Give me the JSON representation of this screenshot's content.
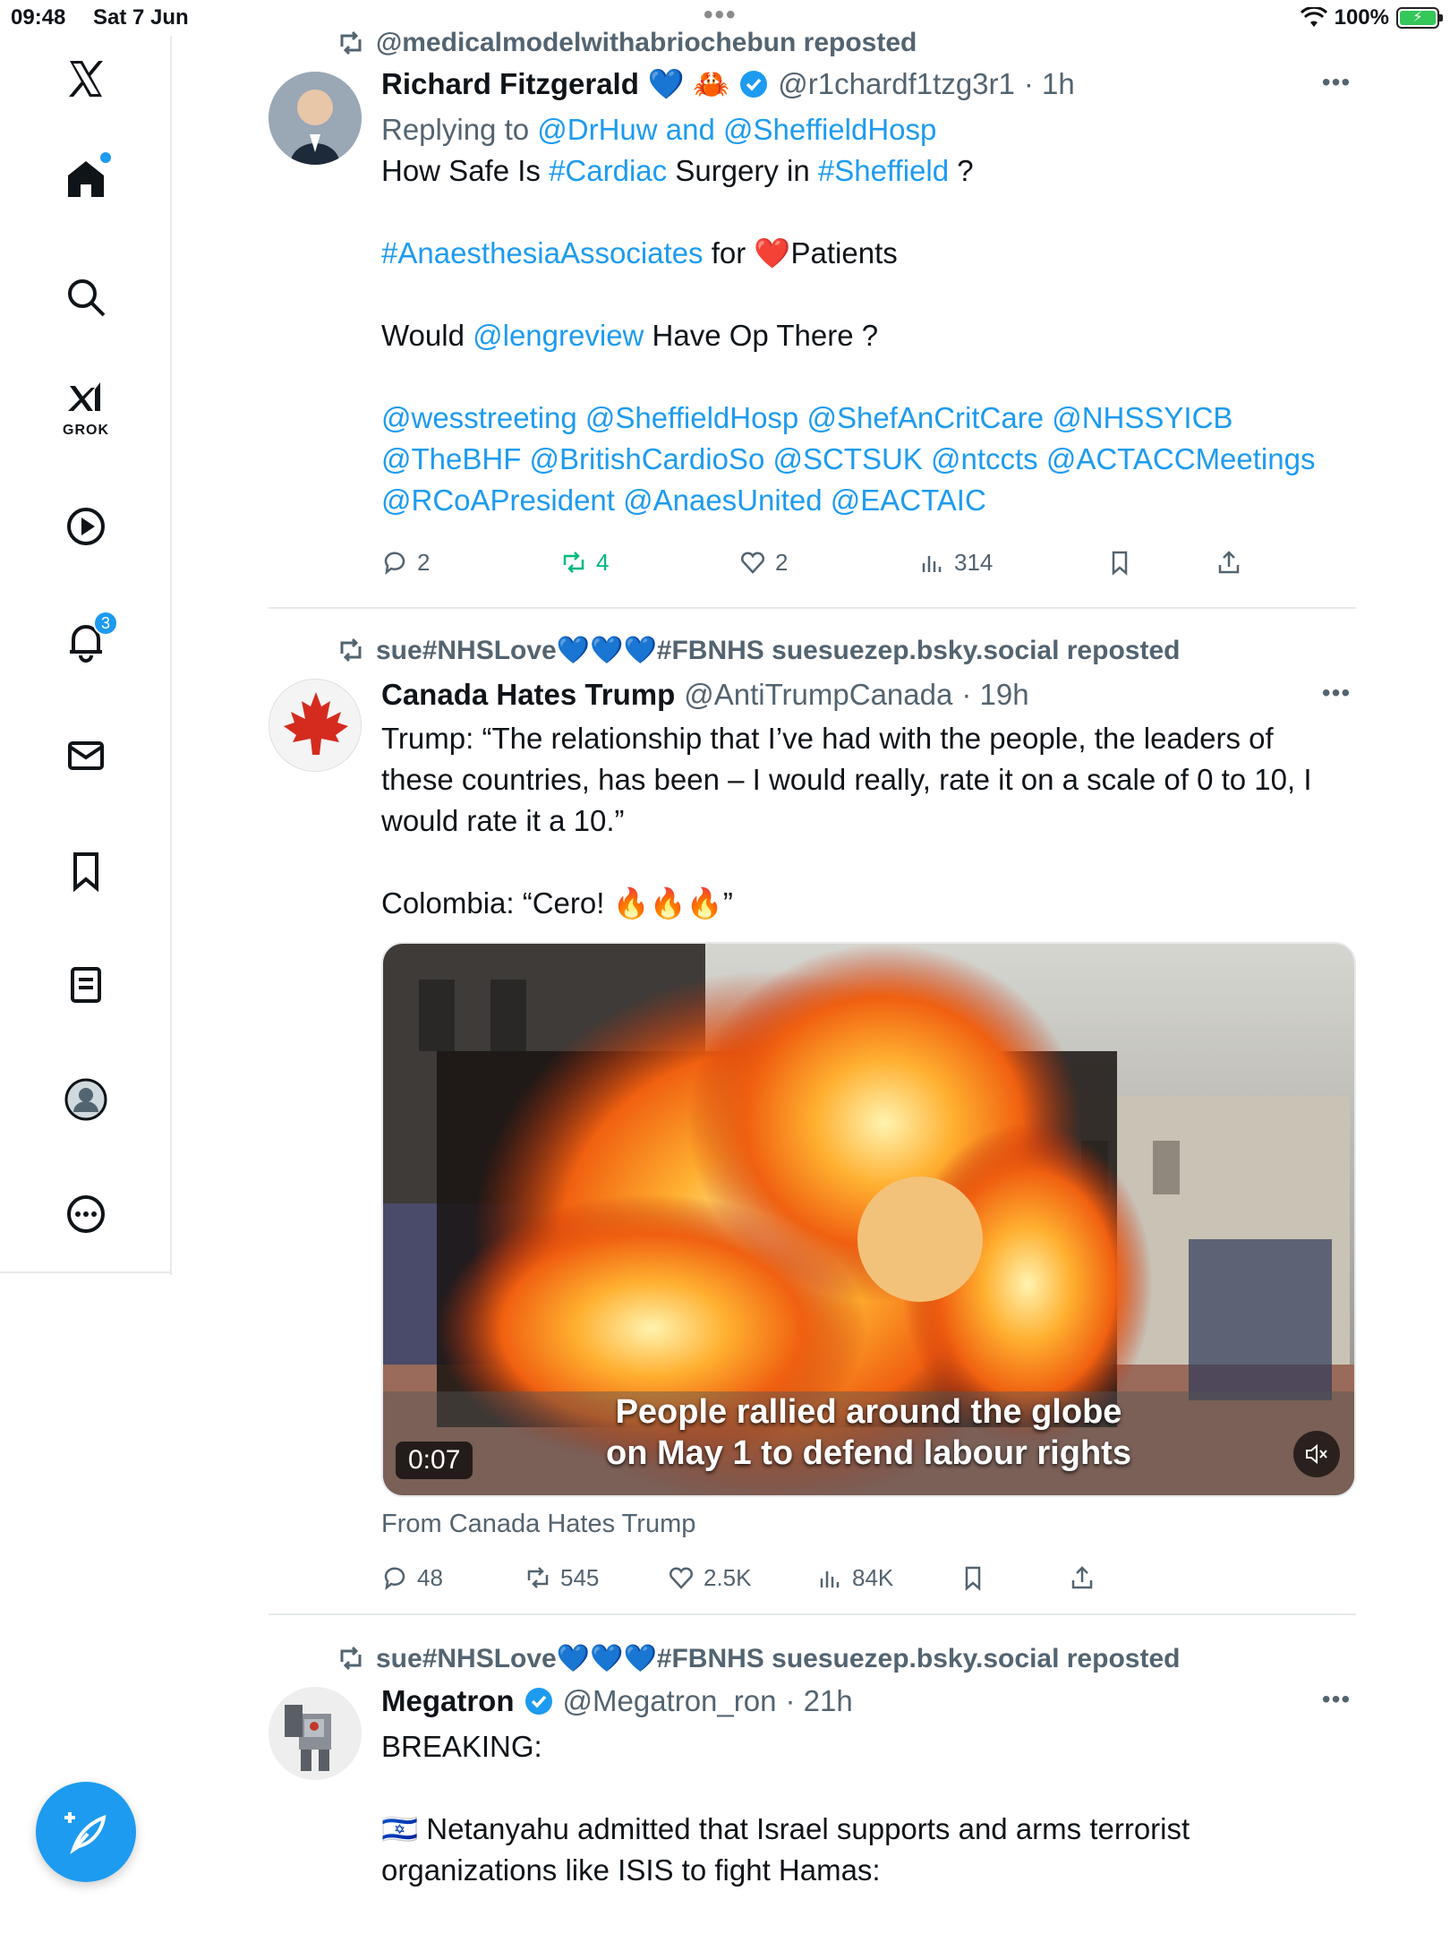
{
  "status_bar": {
    "time": "09:48",
    "date": "Sat 7 Jun",
    "battery": "100%"
  },
  "sidebar": {
    "grok_label": "GROK",
    "notifications_count": "3"
  },
  "tweets": [
    {
      "repost_by": "@medicalmodelwithabriochebun reposted",
      "name": "Richard Fitzgerald",
      "name_emoji": "💙 🦀",
      "handle": "@r1chardf1tzg3r1",
      "time": "· 1h",
      "reply_prefix": "Replying to ",
      "reply_to_1": "@DrHuw",
      "reply_and": " and ",
      "reply_to_2": "@SheffieldHosp",
      "line1_a": "How Safe Is ",
      "line1_b": "#Cardiac",
      "line1_c": " Surgery in ",
      "line1_d": "#Sheffield",
      "line1_e": " ?",
      "line2_a": "#AnaesthesiaAssociates",
      "line2_b": " for ❤️Patients",
      "line3_a": "Would ",
      "line3_b": "@lengreview",
      "line3_c": " Have Op There ?",
      "mentions_1": "@wesstreeting @SheffieldHosp @ShefAnCritCare @NHSSYICB",
      "mentions_2": "@TheBHF @BritishCardioSo @SCTSUK @ntccts @ACTACCMeetings",
      "mentions_3": "@RCoAPresident @AnaesUnited @EACTAIC",
      "replies": "2",
      "reposts": "4",
      "likes": "2",
      "views": "314"
    },
    {
      "repost_by": "sue#NHSLove💙💙💙#FBNHS suesuezep.bsky.social reposted",
      "name": "Canada Hates Trump",
      "handle": "@AntiTrumpCanada",
      "time": "· 19h",
      "text_1": "Trump: “The relationship that I’ve had with the people, the leaders of",
      "text_2": "these countries, has been – I would really, rate it on a scale of 0 to 10, I",
      "text_3": "would rate it a 10.”",
      "text_4": "Colombia: “Cero! 🔥🔥🔥”",
      "video_time": "0:07",
      "video_caption_1": "People rallied around the globe",
      "video_caption_2": "on May 1 to defend labour rights",
      "from": "From Canada Hates Trump",
      "replies": "48",
      "reposts": "545",
      "likes": "2.5K",
      "views": "84K"
    },
    {
      "repost_by": "sue#NHSLove💙💙💙#FBNHS suesuezep.bsky.social reposted",
      "name": "Megatron",
      "handle": "@Megatron_ron",
      "time": "· 21h",
      "text_1": "BREAKING:",
      "text_2": "🇮🇱 Netanyahu admitted that Israel supports and arms terrorist",
      "text_3": "organizations like ISIS to fight Hamas:"
    }
  ],
  "colors": {
    "accent": "#1d9bf0",
    "muted": "#536471",
    "repost_green": "#00ba7c"
  }
}
